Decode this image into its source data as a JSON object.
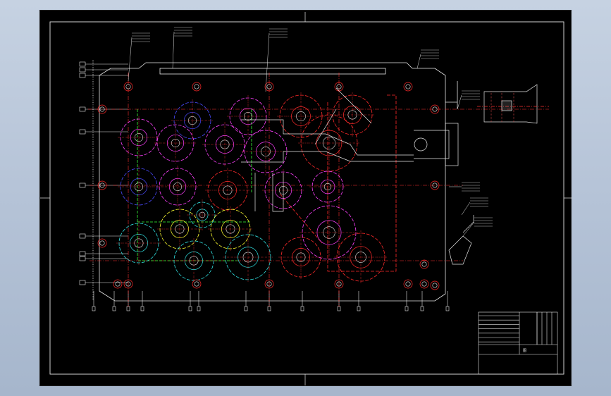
{
  "viewer": {
    "background_top": "#c6d2e2",
    "background_bottom": "#a6b6cc",
    "canvas_color": "#000000"
  },
  "drawing": {
    "type": "2D CAD assembly layout (gearbox housing, top view)",
    "line_colors": {
      "outline": "#e6e6e6",
      "centerline": "#ff3030",
      "gear_red": "#ff2a2a",
      "gear_magenta": "#ff40ff",
      "gear_blue": "#4a4aff",
      "gear_green": "#38ff38",
      "gear_yellow": "#ffff30",
      "gear_cyan": "#30e0e0"
    },
    "title_block": {
      "title": "图",
      "rows": [
        "",
        "",
        "",
        "",
        "",
        ""
      ]
    }
  }
}
